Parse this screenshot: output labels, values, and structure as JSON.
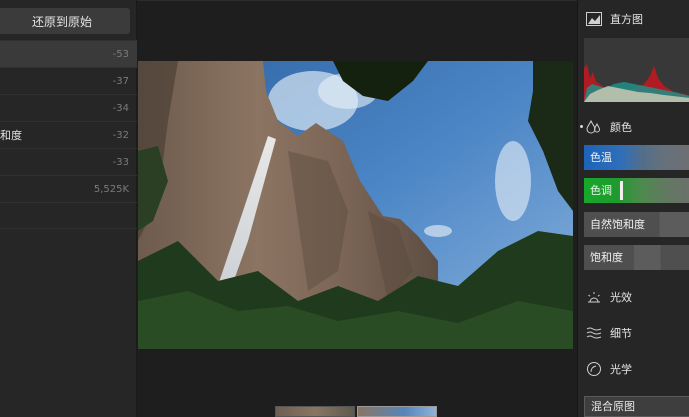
{
  "left_panel": {
    "revert_button": "还原到原始",
    "history": [
      {
        "label": "",
        "value": "-53",
        "selected": true
      },
      {
        "label": "",
        "value": "-37",
        "selected": false
      },
      {
        "label": "",
        "value": "-34",
        "selected": false
      },
      {
        "label": "和度",
        "value": "-32",
        "selected": false
      },
      {
        "label": "",
        "value": "-33",
        "selected": false
      },
      {
        "label": "",
        "value": "5,525K",
        "selected": false
      },
      {
        "label": "",
        "value": "",
        "selected": false
      }
    ]
  },
  "right_panel": {
    "histogram_title": "直方图",
    "color_section_title": "颜色",
    "sliders": {
      "temperature": "色温",
      "tint": "色调",
      "vibrance": "自然饱和度",
      "saturation": "饱和度"
    },
    "sections": {
      "light": "光效",
      "detail": "细节",
      "optics": "光学"
    },
    "merge_button": "混合原图"
  },
  "colors": {
    "temperature_blue": "#1d63b8",
    "tint_green": "#16a82a",
    "panel": "#262626",
    "canvas": "#1e1e1e"
  },
  "icons": [
    "histogram-icon",
    "drops-icon",
    "light-icon",
    "detail-icon",
    "optics-icon"
  ]
}
